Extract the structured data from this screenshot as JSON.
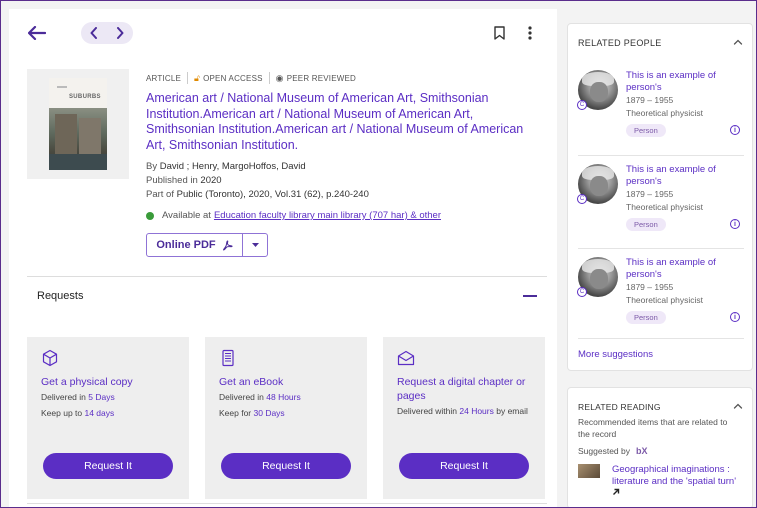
{
  "topbar": {
    "back_icon": "arrow-left-icon",
    "prev_icon": "chevron-left-icon",
    "next_icon": "chevron-right-icon",
    "bookmark_icon": "bookmark-icon",
    "more_icon": "kebab-menu-icon"
  },
  "record": {
    "cover_title": "SUBURBS",
    "type": "ARTICLE",
    "open_access": "OPEN ACCESS",
    "peer_reviewed": "PEER REVIEWED",
    "title": "American art / National Museum of American Art, Smithsonian Institution.American art / National Museum of American Art, Smithsonian Institution.American art / National Museum of American Art, Smithsonian Institution.",
    "by_label": "By",
    "authors": "David ; Henry, MargoHoffos, David",
    "published_label": "Published in",
    "published": "2020",
    "partof_label": "Part of",
    "partof": "Public (Toronto), 2020, Vol.31 (62), p.240-240",
    "available_label": "Available at",
    "available_link": "Education faculty library main library (707 har) & other",
    "pdf_label": "Online PDF"
  },
  "requests": {
    "heading": "Requests",
    "cards": [
      {
        "icon": "cube-icon",
        "title": "Get a physical copy",
        "line1_prefix": "Delivered in ",
        "line1_value": "5 Days",
        "line2_prefix": "Keep up to ",
        "line2_value": "14 days",
        "button": "Request It"
      },
      {
        "icon": "ebook-icon",
        "title": "Get an eBook",
        "line1_prefix": "Delivered in ",
        "line1_value": "48 Hours",
        "line2_prefix": "Keep for ",
        "line2_value": "30 Days",
        "button": "Request It"
      },
      {
        "icon": "envelope-icon",
        "title": "Request a digital chapter or pages",
        "line1_prefix": "Delivered within ",
        "line1_value": "24 Hours",
        "line1_suffix": " by email",
        "button": "Request It"
      }
    ]
  },
  "related_people": {
    "heading": "RELATED PEOPLE",
    "people": [
      {
        "name": "This is an example of person's",
        "years": "1879 – 1955",
        "job": "Theoretical physicist",
        "tag": "Person"
      },
      {
        "name": "This is an example of person's",
        "years": "1879 – 1955",
        "job": "Theoretical physicist",
        "tag": "Person"
      },
      {
        "name": "This is an example of person's",
        "years": "1879 – 1955",
        "job": "Theoretical physicist",
        "tag": "Person"
      }
    ],
    "more": "More suggestions"
  },
  "related_reading": {
    "heading": "RELATED READING",
    "description": "Recommended items that are related to the record",
    "suggested_by": "Suggested by",
    "suggested_logo": "bX",
    "item_title": "Geographical imaginations : literature and the 'spatial turn'"
  },
  "colors": {
    "accent": "#5b2ec4",
    "open_access": "#e08a00",
    "available": "#3a9b3a"
  }
}
